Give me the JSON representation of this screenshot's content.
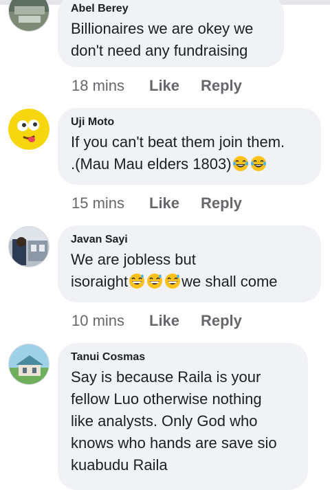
{
  "actions": {
    "like_label": "Like",
    "reply_label": "Reply"
  },
  "comments": [
    {
      "author": "Abel Berey",
      "text_line1": "Billionaires we are okey we",
      "text_line2": "don't need any fundraising",
      "time": "18 mins"
    },
    {
      "author": "Uji Moto",
      "text_line1": "If you can't beat them join them.",
      "text_line2": ".(Mau Mau elders 1803)",
      "emoji": "laughing-tears",
      "time": "15 mins"
    },
    {
      "author": "Javan Sayi",
      "text_line1": "We are jobless but",
      "text_line2a": "isoraight",
      "text_line2b": "we shall come",
      "emoji": "grinning-sweat",
      "time": "10 mins"
    },
    {
      "author": "Tanui Cosmas",
      "text_line1": "Say is because Raila is your",
      "text_line2": "fellow Luo otherwise nothing",
      "text_line3": "like analysts. Only God who",
      "text_line4": "knows who hands are save sio",
      "text_line5": "kuabudu Raila"
    }
  ]
}
